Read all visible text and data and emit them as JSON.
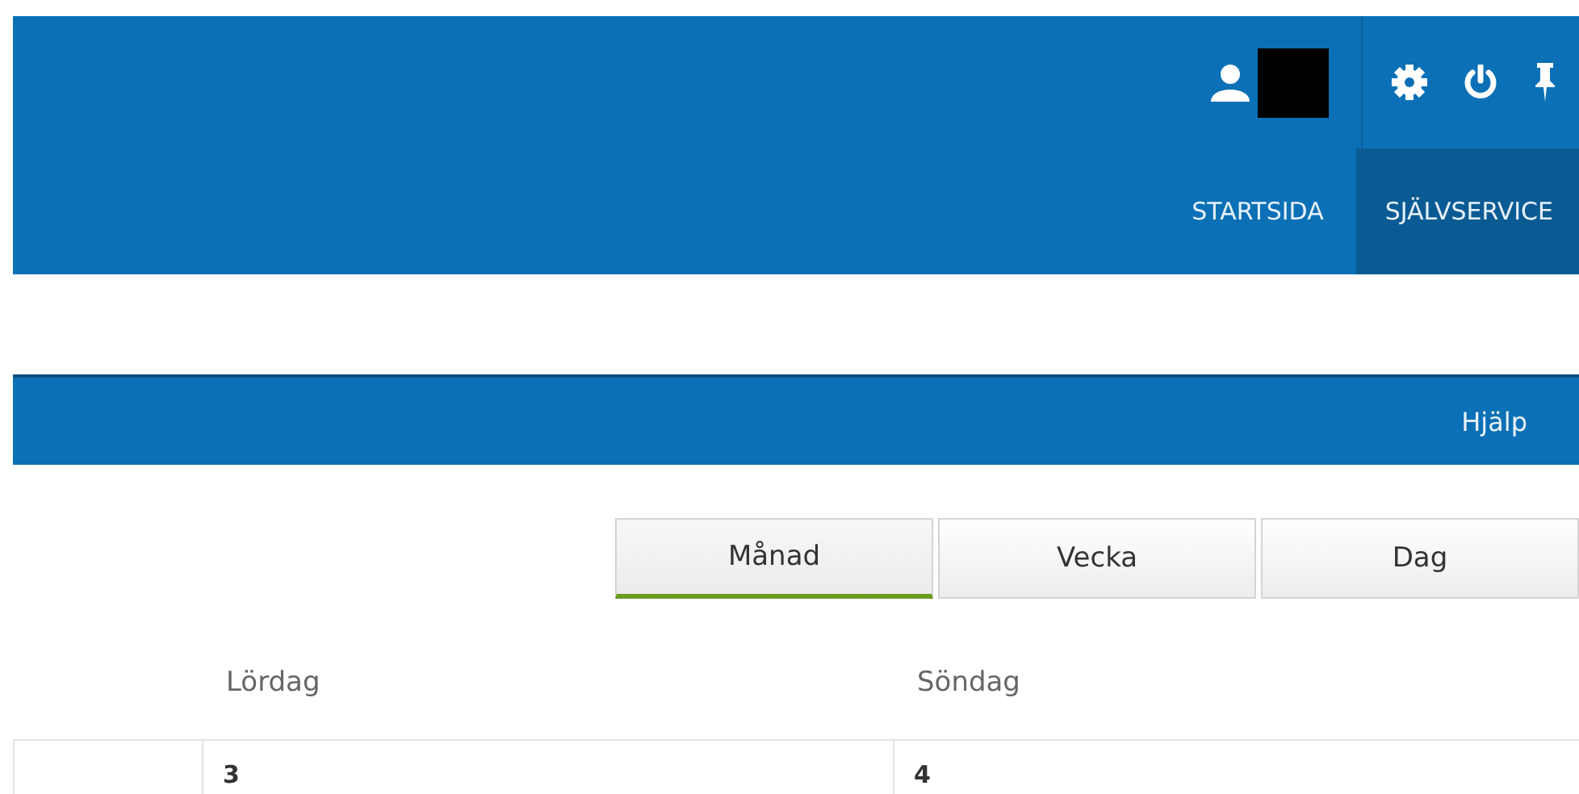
{
  "header": {
    "nav": [
      {
        "label": "STARTSIDA",
        "selected": false
      },
      {
        "label": "SJÄLVSERVICE",
        "selected": true
      }
    ]
  },
  "toolbar": {
    "help_link": "Hjälp"
  },
  "view_switch": [
    {
      "label": "Månad",
      "selected": true
    },
    {
      "label": "Vecka",
      "selected": false
    },
    {
      "label": "Dag",
      "selected": false
    }
  ],
  "calendar": {
    "columns": [
      {
        "day": "Lördag",
        "date": "3"
      },
      {
        "day": "Söndag",
        "date": "4"
      }
    ]
  }
}
